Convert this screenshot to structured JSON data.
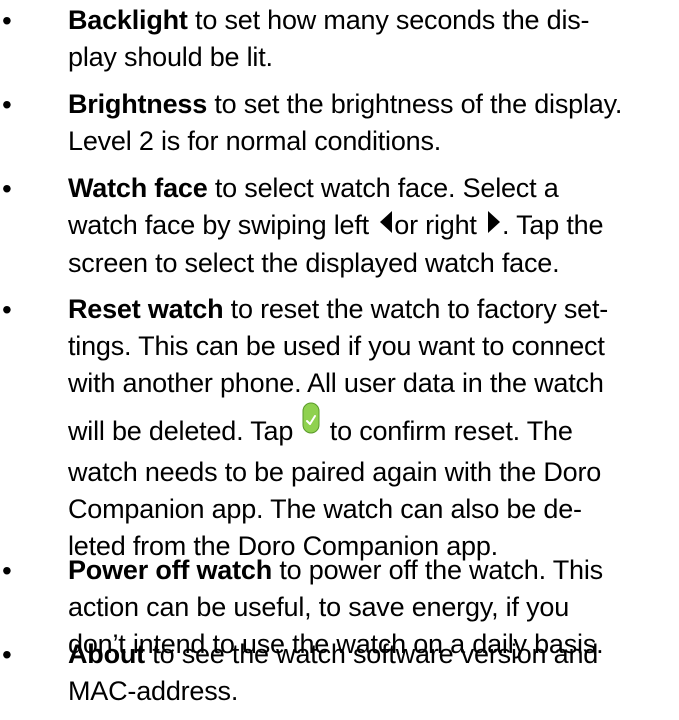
{
  "items": [
    {
      "term": "Backlight",
      "line1": " to set how many seconds the dis-",
      "line2": "play should be lit."
    },
    {
      "term": "Brightness",
      "line1": " to set the brightness of the display.",
      "line2": "Level 2 is for normal conditions."
    },
    {
      "term": "Watch face",
      "line1": " to select watch face. Select a",
      "line2a": "watch face by swiping left ",
      "line2b": "or right ",
      "line2c": ". Tap the",
      "line3": "screen to select the displayed watch face.",
      "icons": [
        "triangle-left-icon",
        "triangle-right-icon"
      ]
    },
    {
      "term": "Reset watch",
      "line1": " to reset the watch to factory set-",
      "line2": "tings. This can be used if you want to connect",
      "line3": "with another phone. All user data in the watch",
      "line4a": "will be deleted. Tap ",
      "line4b": " to confirm reset. The",
      "line5": "watch needs to be paired again with the Doro",
      "line6": "Companion app. The watch can also be de-",
      "line7": "leted from the Doro Companion app.",
      "icon": "confirm-check-icon",
      "icon_color": "#8fd14f"
    },
    {
      "term": "Power off watch",
      "line1": " to power off the watch. This",
      "line2": "action can be useful, to save energy, if you",
      "line3": "don’t intend to use the watch on a daily basis."
    },
    {
      "term": "About",
      "line1": " to see the watch software version and",
      "line2": "MAC-address."
    }
  ],
  "bullet_char": "•"
}
